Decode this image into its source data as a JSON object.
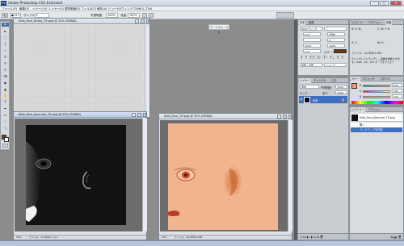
{
  "app": {
    "title": "Adobe Photoshop CS3 Extended",
    "icon_label": "Ps",
    "window_buttons": [
      "–",
      "□",
      "×"
    ]
  },
  "menu": [
    "ファイル(F)",
    "編集(E)",
    "イメージ(I)",
    "レイヤー(L)",
    "選択範囲(S)",
    "フィルタ(T)",
    "解析(A)",
    "ビュー(V)",
    "ウィンドウ(W)",
    "ヘルプ(H)"
  ],
  "options": {
    "sample_label": "サンプル:",
    "opacity_label": "不透明度:",
    "opacity_value": "100%",
    "flow_label": "流量:",
    "flow_value": "100%",
    "workspace_label": "ワークスペース ▾"
  },
  "tools": [
    "►",
    "⬚",
    "ʃ",
    "✧",
    "⌗",
    "✎",
    "✐",
    "⌫",
    "◉",
    "▲",
    "✋",
    "T",
    "✒",
    "▭",
    "☝",
    "🔍"
  ],
  "documents": {
    "bump": {
      "title": "Kida_Face_Bump_TX.png @ 25% (RGB/8)",
      "status": ""
    },
    "specular": {
      "title": "Kida_Face_Specular_TX.png @ 25% (RGB/8)",
      "zoom": "25%",
      "status": "ファイル : 12.0M/0 バイト"
    },
    "color": {
      "title": "Kida_Face_TX.png @ 25% (RGB/8)",
      "zoom": "25%",
      "status": "ファイル : 12.0M/12.0M"
    }
  },
  "char_panel": {
    "tabs": [
      "文字",
      "段落"
    ],
    "font": "MS Pゴシック",
    "style": "-",
    "size": "6 pt",
    "leading": "(自動)",
    "tracking": "0",
    "scale_v": "100%",
    "scale_h": "100%",
    "baseline": "0 pt",
    "color_label": "カラー:",
    "language": "英語 : 米国",
    "aa": "シャープ"
  },
  "hist_panel": {
    "tabs": [
      "ヒストリー",
      "アクション"
    ],
    "tab_info": "情報",
    "file_label": "ファイル : 12.0M/12.0M",
    "hint": "クリックしてドラッグし、画像を移動させます。Shift、Alt、Ctrl キーでオプション"
  },
  "layers_panel": {
    "tabs": [
      "レイヤー",
      "チャンネル",
      "パス"
    ],
    "blend": "通常",
    "opacity_label": "不透明度:",
    "opacity": "100%",
    "lock_label": "ロック:",
    "fill_label": "塗り:",
    "fill": "100%",
    "layer_name": "背景"
  },
  "color_panel": {
    "tabs": [
      "カラー",
      "スウォッチ",
      "スタイル"
    ],
    "r": "R",
    "g": "G",
    "b": "B",
    "r_val": "255",
    "g_val": "156",
    "b_val": "104",
    "swatch_color": "#ff9c68"
  },
  "history_panel": {
    "tabs": [
      "ヒストリー",
      "アクション"
    ],
    "snapshot": "Kida_Face_Specular_TX.png",
    "items": [
      "開く",
      "バックアップを作成"
    ]
  },
  "colors": {
    "title_active": "#b6cbe2",
    "selection": "#3d6fc2",
    "skin": "#f0b48e",
    "specular_bg": "#121212"
  }
}
